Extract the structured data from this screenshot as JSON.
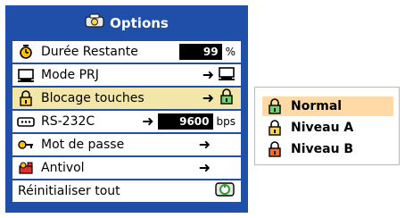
{
  "panel": {
    "title": "Options",
    "title_icon": "options-icon",
    "rows": [
      {
        "label": "Durée Restante",
        "icon": "clock-icon",
        "value": "99",
        "unit": "%",
        "has_arrow": false
      },
      {
        "label": "Mode PRJ",
        "icon": "projection-mode-icon",
        "has_arrow": true,
        "right_icon": "projection-mode-icon"
      },
      {
        "label": "Blocage touches",
        "icon": "lock-icon",
        "has_arrow": true,
        "right_icon": "lock-icon",
        "selected": true
      },
      {
        "label": "RS-232C",
        "icon": "rs232-icon",
        "value": "9600",
        "unit": "bps",
        "has_arrow": true
      },
      {
        "label": "Mot de passe",
        "icon": "password-icon",
        "has_arrow": true
      },
      {
        "label": "Antivol",
        "icon": "antitheft-icon",
        "has_arrow": true
      },
      {
        "label": "Réinitialiser tout",
        "icon": null,
        "right_icon": "reset-icon"
      }
    ]
  },
  "submenu": {
    "items": [
      {
        "label": "Normal",
        "icon": "lock-green-icon",
        "selected": true
      },
      {
        "label": "Niveau A",
        "icon": "lock-yellow-icon",
        "selected": false
      },
      {
        "label": "Niveau B",
        "icon": "lock-red-icon",
        "selected": false
      }
    ]
  },
  "arrow_glyph": "➜",
  "colors": {
    "panel_bg": "#1f4fa8",
    "selected_row": "#f2e6a8",
    "submenu_selected": "#ffd9a6",
    "value_box": "#000000"
  }
}
